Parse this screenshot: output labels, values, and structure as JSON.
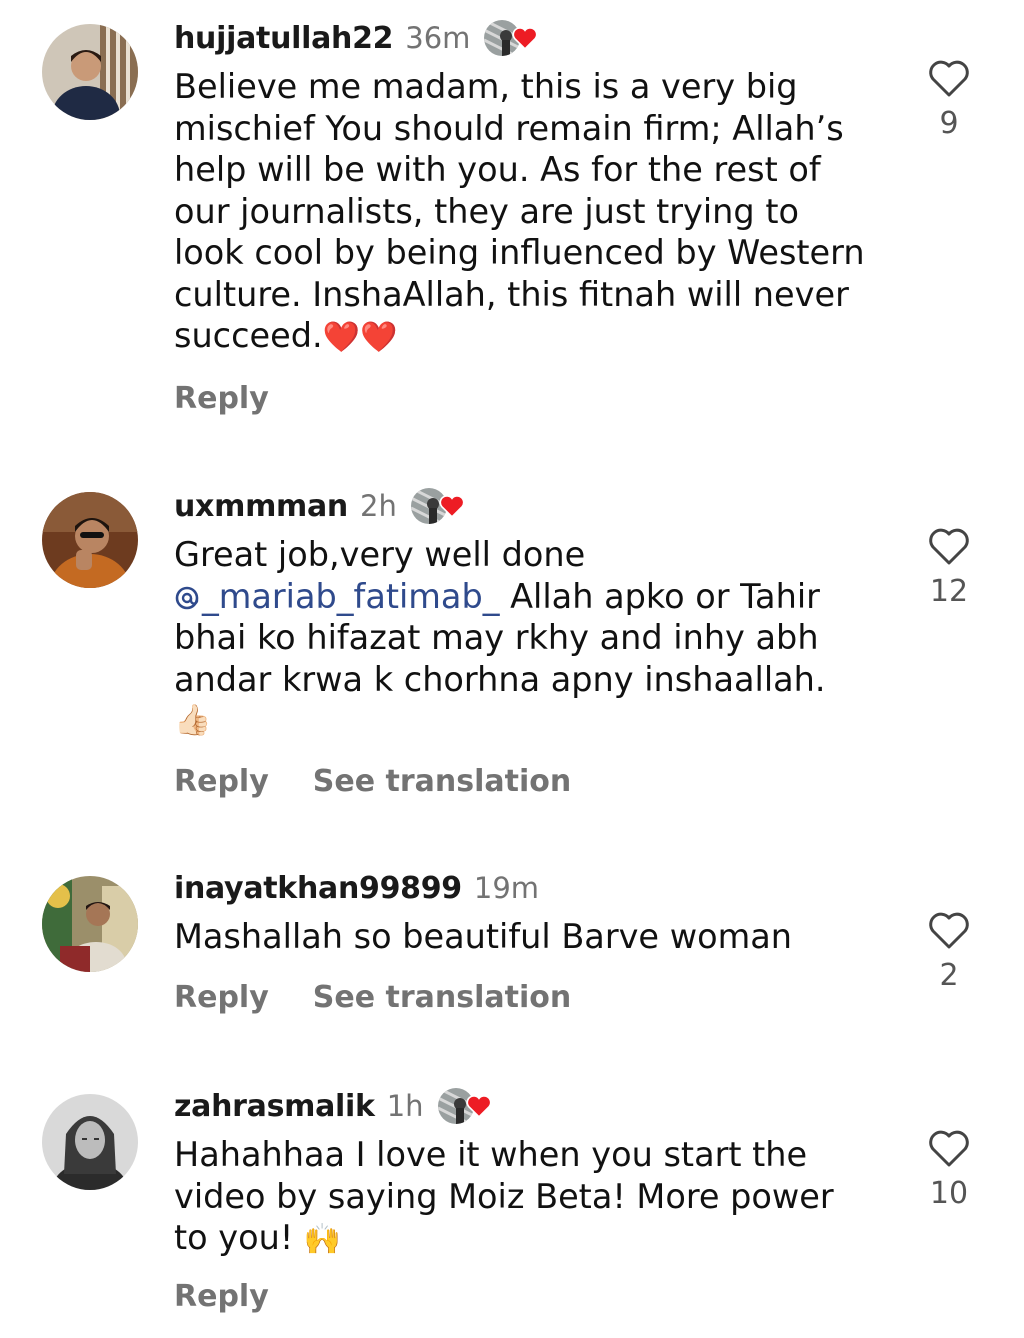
{
  "comments": [
    {
      "username": "hujjatullah22",
      "time": "36m",
      "liked_by_author": true,
      "text_lines": [
        "Believe me madam, this is a very big",
        "mischief You should remain firm; Allah’s",
        "help will be with you. As for the rest of",
        "our journalists, they are just trying to",
        "look cool by being influenced by Western",
        "culture. InshaAllah, this fitnah will never",
        "succeed."
      ],
      "emoji_suffix": "❤️❤️",
      "reply_label": "Reply",
      "like_count": "9"
    },
    {
      "username": "uxmmman",
      "time": "2h",
      "liked_by_author": true,
      "line1": "Great job,very well done",
      "mention": "_mariab_fatimab_",
      "line2_rest": " Allah apko or Tahir",
      "line3": "bhai ko hifazat may rkhy and inhy abh",
      "line4": "andar krwa k chorhna apny inshaallah.",
      "emoji_line": "👍🏻",
      "reply_label": "Reply",
      "translate_label": "See translation",
      "like_count": "12"
    },
    {
      "username": "inayatkhan99899",
      "time": "19m",
      "liked_by_author": false,
      "text": "Mashallah so beautiful  Barve woman",
      "reply_label": "Reply",
      "translate_label": "See translation",
      "like_count": "2"
    },
    {
      "username": "zahrasmalik",
      "time": "1h",
      "liked_by_author": true,
      "line1": "Hahahhaa I love it when you start the",
      "line2": "video by saying Moiz Beta! More power",
      "line3": "to you!",
      "emoji_suffix": "🙌",
      "reply_label": "Reply",
      "like_count": "10"
    }
  ],
  "icons": {
    "like": "heart-outline-icon",
    "author_like": "red-heart-icon",
    "mention": "threads-icon"
  },
  "colors": {
    "secondary_text": "#737373",
    "mention": "#2f4a8c",
    "heart_red": "#ed1c24"
  }
}
